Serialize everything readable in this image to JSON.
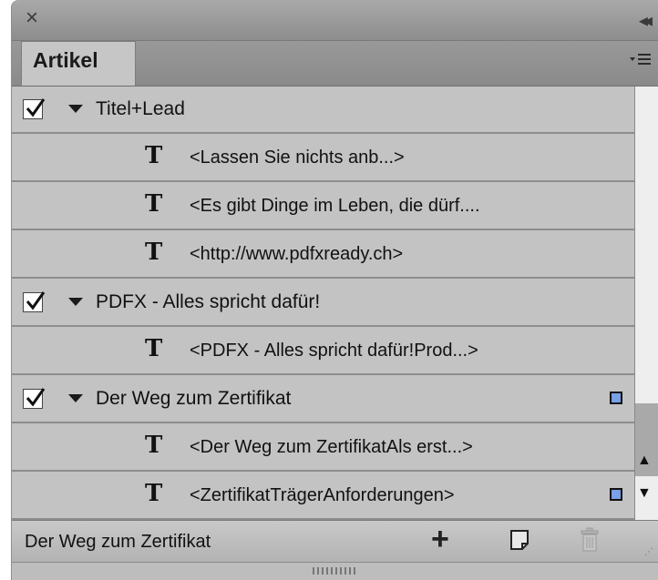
{
  "titlebar": {
    "close_glyph": "×",
    "collapse_glyph": "◂◂"
  },
  "tab": {
    "label": "Artikel"
  },
  "articles": [
    {
      "title": "Titel+Lead",
      "checked": true,
      "badge": false,
      "items": [
        {
          "label": "<Lassen Sie nichts anb...>",
          "badge": false
        },
        {
          "label": "<Es gibt Dinge im Leben, die dürf....",
          "badge": false
        },
        {
          "label": "<http://www.pdfxready.ch>",
          "badge": false
        }
      ]
    },
    {
      "title": "PDFX - Alles spricht dafür!",
      "checked": true,
      "badge": false,
      "items": [
        {
          "label": "<PDFX - Alles spricht dafür!Prod...>",
          "badge": false
        }
      ]
    },
    {
      "title": "Der Weg zum Zertifikat",
      "checked": true,
      "badge": true,
      "items": [
        {
          "label": "<Der Weg zum ZertifikatAls erst...>",
          "badge": false
        },
        {
          "label": "<ZertifikatTrägerAnforderungen>",
          "badge": true
        }
      ]
    }
  ],
  "text_frame_glyph": "T",
  "footer": {
    "selected_article": "Der Weg zum Zertifikat"
  },
  "colors": {
    "badge_blue": "#7aa0e6",
    "panel_gray": "#c3c3c3"
  },
  "icons": {
    "close": "close-icon",
    "collapse": "double-arrow-left-icon",
    "panel_menu": "panel-menu-icon",
    "add": "plus-icon",
    "new_article": "new-article-icon",
    "delete": "trash-icon"
  }
}
